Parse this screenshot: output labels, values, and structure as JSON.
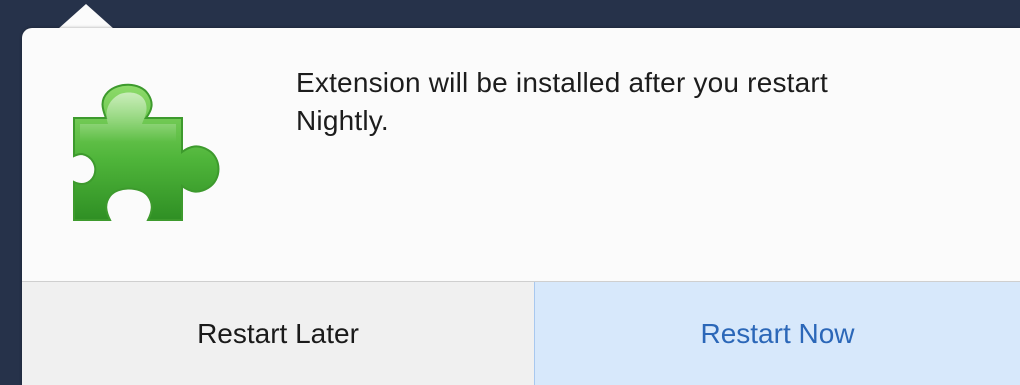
{
  "notification": {
    "message": "Extension will be installed after you restart Nightly.",
    "icon": "puzzle-piece-icon",
    "icon_color": "#4fb53a"
  },
  "buttons": {
    "restart_later_label": "Restart Later",
    "restart_now_label": "Restart Now"
  },
  "colors": {
    "accent": "#2b67b8",
    "primary_button_bg": "#d7e8fb",
    "secondary_button_bg": "#f0f0f0",
    "backdrop": "#26324a"
  }
}
